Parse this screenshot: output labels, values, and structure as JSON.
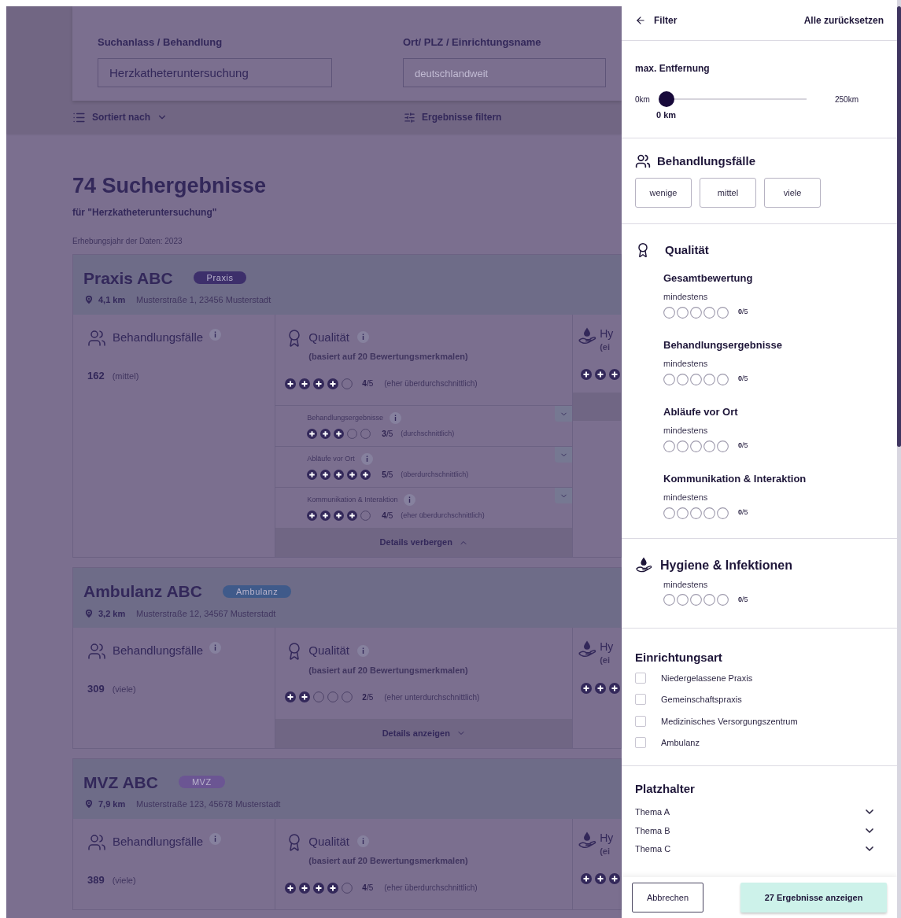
{
  "search": {
    "fields": [
      {
        "label": "Suchanlass / Behandlung",
        "value": "Herzkatheteruntersuchung"
      },
      {
        "label": "Ort/ PLZ / Einrichtungsname",
        "placeholder": "deutschlandweit"
      }
    ]
  },
  "toolbar": {
    "sort": "Sortiert nach",
    "filter": "Ergebnisse filtern"
  },
  "results": {
    "title": "74 Suchergebnisse",
    "subtitle": "für \"Herzkatheteruntersuchung\"",
    "year": "Erhebungsjahr der Daten: 2023"
  },
  "cards": [
    {
      "name": "Praxis ABC",
      "badge": {
        "label": "Praxis",
        "color": "#3d2f6b"
      },
      "distance": "4,1 km",
      "address": "Musterstraße 1, 23456 Musterstadt",
      "cases": {
        "title": "Behandlungsfälle",
        "count": "162",
        "level_text": "(mittel)"
      },
      "quality": {
        "title": "Qualität",
        "subtitle": "(basiert auf 20 Bewertungsmerkmalen)",
        "stars": 4,
        "score": "**4**/5",
        "verdict": "(eher überdurchschnittlich)"
      },
      "hygiene": {
        "title": "Hy",
        "subtitle": "(ei",
        "stars": 3
      },
      "expanded": true,
      "details": [
        {
          "title": "Behandlungsergebnisse",
          "stars": 3,
          "score": "**3**/5",
          "verdict": "(durchschnittlich)"
        },
        {
          "title": "Abläufe vor Ort",
          "stars": 5,
          "score": "**5**/5",
          "verdict": "(überdurchschnittlich)"
        },
        {
          "title": "Kommunikation & Interaktion",
          "stars": 4,
          "score": "**4**/5",
          "verdict": "(eher überdurchschnittlich)"
        }
      ],
      "details_button": "Details verbergen"
    },
    {
      "name": "Ambulanz ABC",
      "badge": {
        "label": "Ambulanz",
        "color": "#3f5a8a"
      },
      "distance": "3,2 km",
      "address": "Musterstraße 12, 34567 Musterstadt",
      "cases": {
        "title": "Behandlungsfälle",
        "count": "309",
        "level_text": "(viele)"
      },
      "quality": {
        "title": "Qualität",
        "subtitle": "(basiert auf 20 Bewertungsmerkmalen)",
        "stars": 2,
        "score": "**2**/5",
        "verdict": "(eher unterdurchschnittlich)"
      },
      "hygiene": {
        "title": "Hy",
        "subtitle": "(ei",
        "stars": 3
      },
      "expanded": false,
      "details_button": "Details anzeigen"
    },
    {
      "name": "MVZ ABC",
      "badge": {
        "label": "MVZ",
        "color": "#6b5593"
      },
      "distance": "7,9 km",
      "address": "Musterstraße 123, 45678 Musterstadt",
      "cases": {
        "title": "Behandlungsfälle",
        "count": "389",
        "level_text": "(viele)"
      },
      "quality": {
        "title": "Qualität",
        "subtitle": "(basiert auf 20 Bewertungsmerkmalen)",
        "stars": 4,
        "score": "**4**/5",
        "verdict": "(eher überdurchschnittlich)"
      },
      "hygiene": {
        "title": "Hy",
        "subtitle": "(ei",
        "stars": 3
      },
      "expanded": false
    }
  ],
  "filter_panel": {
    "back": "Filter",
    "reset": "Alle zurücksetzen",
    "distance": {
      "title": "max. Entfernung",
      "min": "0km",
      "max": "250km",
      "level": 0,
      "reading": "0 km"
    },
    "cases": {
      "title": "Behandlungsfälle",
      "options": [
        {
          "label": "wenige",
          "selected": false
        },
        {
          "label": "mittel",
          "selected": false
        },
        {
          "label": "viele",
          "selected": false
        }
      ]
    },
    "quality": {
      "title": "Qualität",
      "criteria": [
        {
          "title": "Gesamtbewertung",
          "hint": "mindestens",
          "stars": 0,
          "score": "**0**/5"
        },
        {
          "title": "Behandlungsergebnisse",
          "hint": "mindestens",
          "stars": 0,
          "score": "**0**/5"
        },
        {
          "title": "Abläufe vor Ort",
          "hint": "mindestens",
          "stars": 0,
          "score": "**0**/5"
        },
        {
          "title": "Kommunikation & Interaktion",
          "hint": "mindestens",
          "stars": 0,
          "score": "**0**/5"
        }
      ]
    },
    "hygiene": {
      "title": "Hygiene & Infektionen",
      "hint": "mindestens",
      "stars": 0,
      "score": "**0**/5"
    },
    "facility_type": {
      "title": "Einrichtungsart",
      "options": [
        {
          "label": "Niedergelassene Praxis",
          "checked": false
        },
        {
          "label": "Gemeinschaftspraxis",
          "checked": false
        },
        {
          "label": "Medizinisches Versorgungszentrum",
          "checked": false
        },
        {
          "label": "Ambulanz",
          "checked": false
        }
      ]
    },
    "placeholder_section": {
      "title": "Platzhalter",
      "items": [
        {
          "label": "Thema A",
          "expanded": false
        },
        {
          "label": "Thema B",
          "expanded": false
        },
        {
          "label": "Thema C",
          "expanded": false
        }
      ]
    },
    "actions": {
      "cancel": "Abbrechen",
      "apply": "27 Ergebnisse anzeigen"
    }
  }
}
